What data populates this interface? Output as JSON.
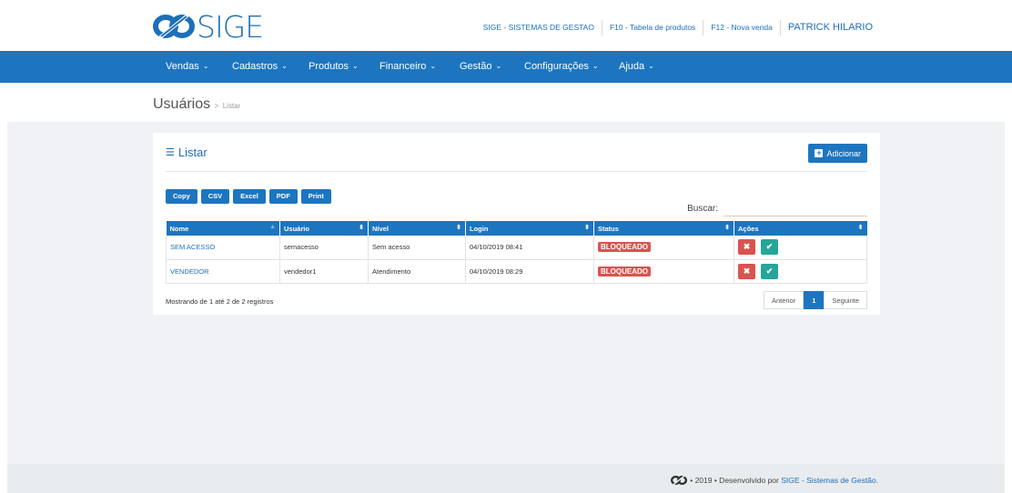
{
  "brand": {
    "name": "SIGE",
    "color": "#1d75c0"
  },
  "toplinks": {
    "company": "SIGE - SISTEMAS DE GESTAO",
    "f10": "F10 - Tabela de produtos",
    "f12": "F12 - Nova venda",
    "user": "PATRICK HILARIO"
  },
  "nav": {
    "caret": "⌄",
    "items": [
      "Vendas",
      "Cadastros",
      "Produtos",
      "Financeiro",
      "Gestão",
      "Configurações",
      "Ajuda"
    ]
  },
  "breadcrumb": {
    "title": "Usuários",
    "sep": ">",
    "sub": "Listar"
  },
  "panel": {
    "title": "Listar",
    "add_button": "Adicionar",
    "exports": [
      "Copy",
      "CSV",
      "Excel",
      "PDF",
      "Print"
    ],
    "search_label": "Buscar:",
    "search_value": ""
  },
  "table": {
    "columns": [
      "Nome",
      "Usuário",
      "Nível",
      "Login",
      "Status",
      "Ações"
    ],
    "rows": [
      {
        "nome": "SEM ACESSO",
        "usuario": "semacesso",
        "nivel": "Sem acesso",
        "login": "04/10/2019 08:41",
        "status": "BLOQUEADO"
      },
      {
        "nome": "VENDEDOR",
        "usuario": "vendedor1",
        "nivel": "Atendimento",
        "login": "04/10/2019 08:29",
        "status": "BLOQUEADO"
      }
    ],
    "info": "Mostrando de 1 até 2 de 2 registros",
    "pager": {
      "prev": "Anterior",
      "page": "1",
      "next": "Seguinte"
    }
  },
  "footer": {
    "prefix": "• 2019 • Desenvolvido por",
    "link": "SIGE - Sistemas de Gestão."
  }
}
